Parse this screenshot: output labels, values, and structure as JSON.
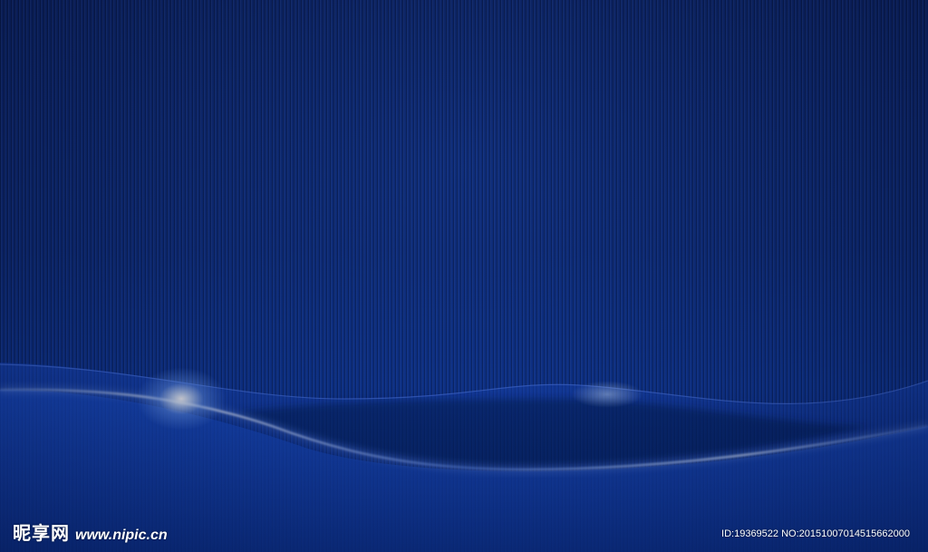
{
  "colors": {
    "background": "#0c2b78",
    "wave_highlight": "#cfe2ff",
    "flare": "#ffffff"
  },
  "watermark": {
    "logo_cn": "昵享网",
    "logo_url": "www.nipic.cn",
    "id_text": "ID:19369522 NO:20151007014515662000"
  }
}
